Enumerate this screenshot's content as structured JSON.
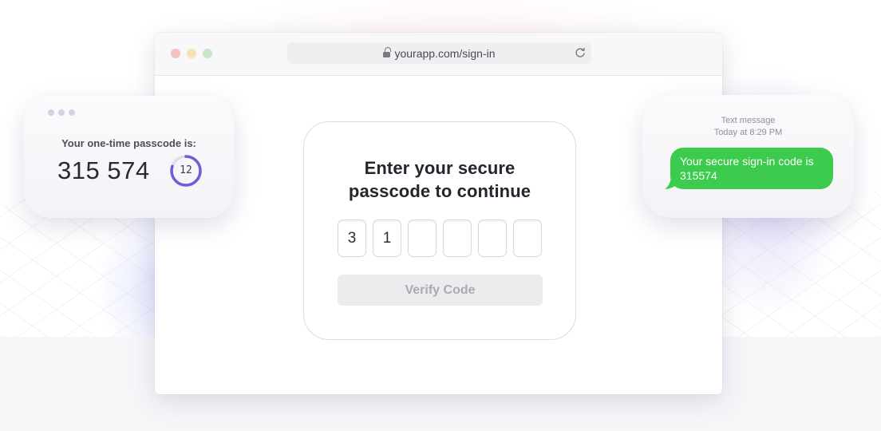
{
  "browser": {
    "url": "yourapp.com/sign-in",
    "lock_icon": "lock-icon",
    "reload_icon": "reload-icon",
    "window_controls": [
      "close",
      "minimize",
      "maximize"
    ]
  },
  "passcode_card": {
    "title_line1": "Enter your secure",
    "title_line2": "passcode to continue",
    "digits": [
      "3",
      "1",
      "",
      "",
      "",
      ""
    ],
    "verify_label": "Verify Code"
  },
  "authenticator": {
    "label": "Your one-time passcode is:",
    "code": "315 574",
    "timer_seconds": "12",
    "timer_progress": 0.8,
    "accent": "#6b5fd8"
  },
  "sms": {
    "meta_line1": "Text message",
    "meta_line2": "Today at 8:29 PM",
    "message": "Your secure sign-in code is 315574",
    "bubble_color": "#3ccb4c"
  }
}
